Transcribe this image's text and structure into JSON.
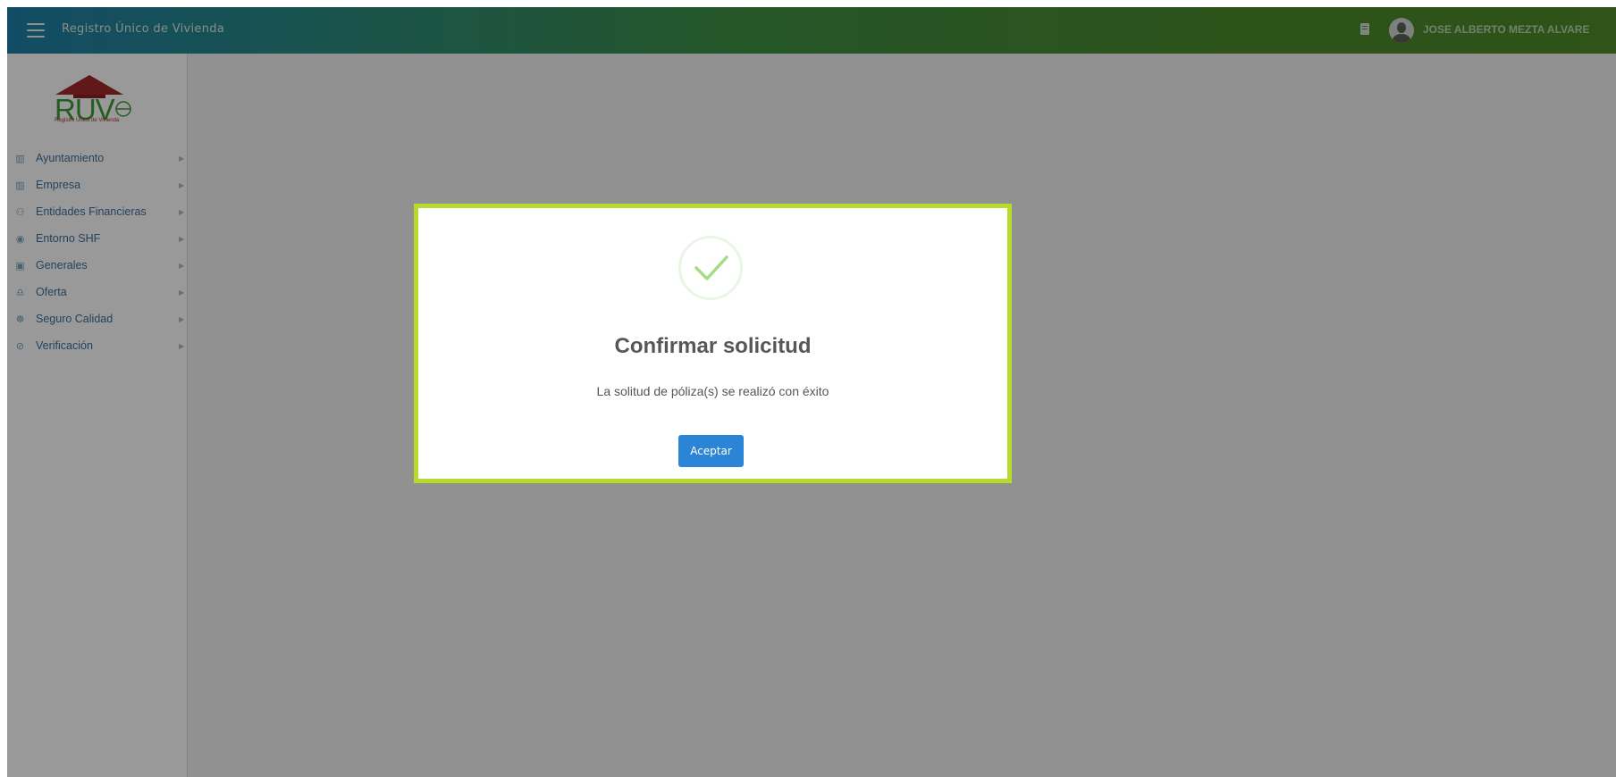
{
  "header": {
    "app_title": "Registro Único de Vivienda",
    "user_name": "JOSE ALBERTO MEZTA ALVARE",
    "icons": [
      "menu-icon",
      "notification-icon",
      "user-avatar"
    ]
  },
  "logo": {
    "text": "RUV",
    "subtitle": "Registro Único de Vivienda"
  },
  "sidebar": {
    "items": [
      {
        "label": "Ayuntamiento",
        "icon": "map-icon",
        "glyph": "▥"
      },
      {
        "label": "Empresa",
        "icon": "building-icon",
        "glyph": "▥"
      },
      {
        "label": "Entidades Financieras",
        "icon": "people-icon",
        "glyph": "⚇"
      },
      {
        "label": "Entorno SHF",
        "icon": "target-icon",
        "glyph": "◉"
      },
      {
        "label": "Generales",
        "icon": "id-card-icon",
        "glyph": "▣"
      },
      {
        "label": "Oferta",
        "icon": "user-offer-icon",
        "glyph": "♎"
      },
      {
        "label": "Seguro Calidad",
        "icon": "handshake-icon",
        "glyph": "☸"
      },
      {
        "label": "Verificación",
        "icon": "check-circle-icon",
        "glyph": "⊘"
      }
    ],
    "arrow_glyph": "▶"
  },
  "modal": {
    "icon": "success-check-icon",
    "title": "Confirmar solicitud",
    "message": "La solitud de póliza(s) se realizó con éxito",
    "accept_label": "Aceptar"
  },
  "colors": {
    "header_start": "#1f7fa8",
    "header_end": "#4f8a2a",
    "modal_border": "#b8db2b",
    "success": "#a5dc86",
    "button": "#2b84d6",
    "menu_text": "#3d6f9c"
  }
}
